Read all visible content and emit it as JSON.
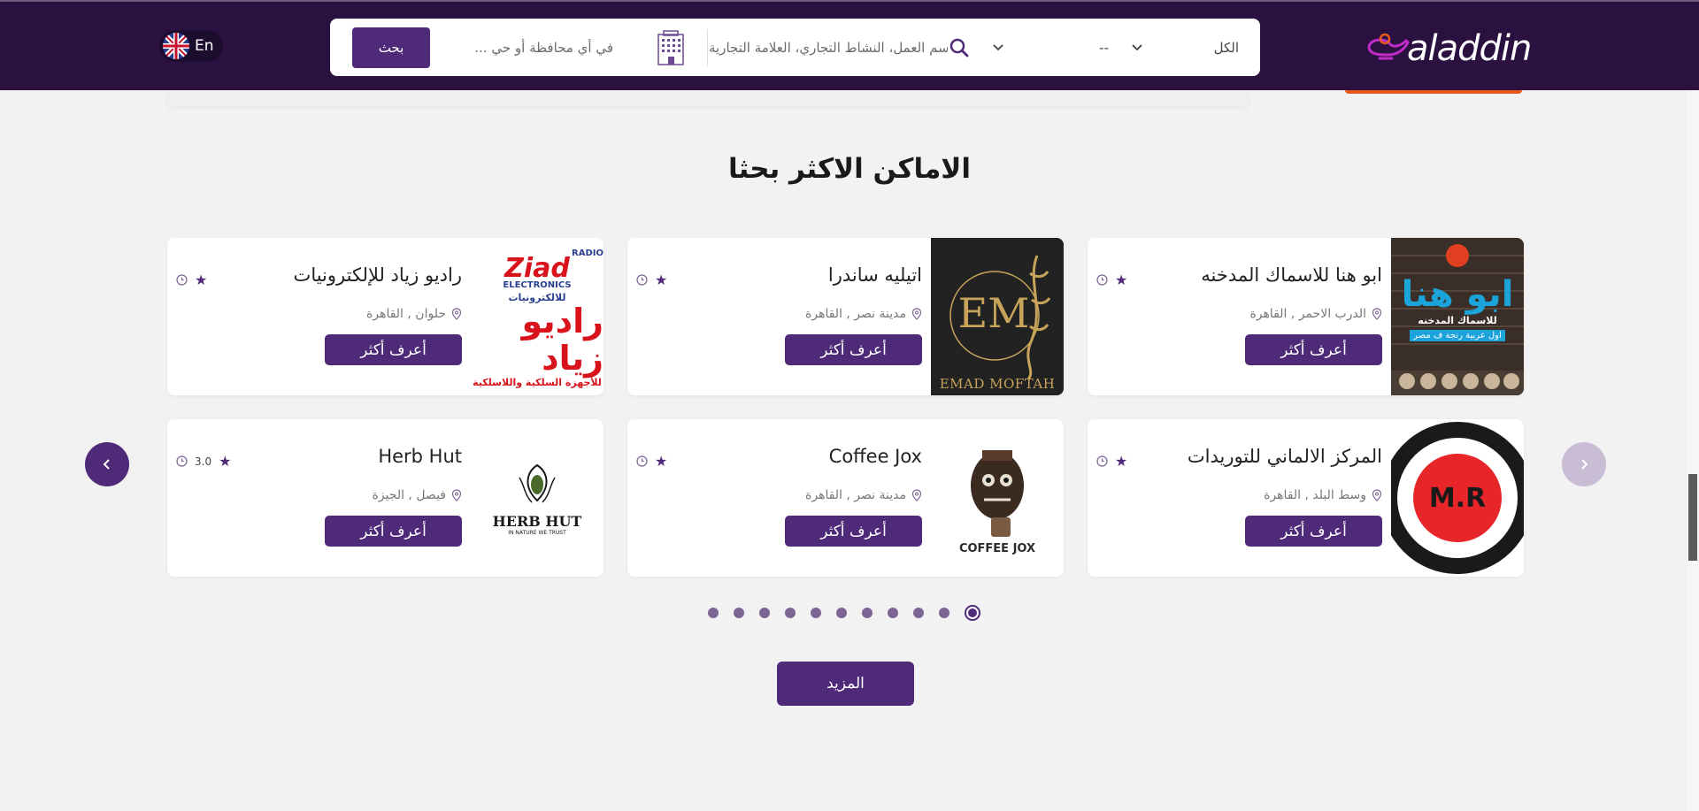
{
  "header": {
    "logo_text": "aladdin",
    "search_button": "بحث",
    "location_placeholder": "... في أي محافظة أو حي",
    "keyword_placeholder": "ابحث بـ اسم العمل، النشاط التجاري، العلامة التجارية",
    "select_category": "الكل",
    "select_sub": "--",
    "language": "En"
  },
  "section": {
    "title": "الاماكن الاكثر بحثا"
  },
  "cards": [
    {
      "name": "ابو هنا للاسماك المدخنه",
      "location": "الدرب الاحمر , القاهرة",
      "button": "أعرف أكثر",
      "rating": ""
    },
    {
      "name": "اتيليه ساندرا",
      "location": "مدينة نصر , القاهرة",
      "button": "أعرف أكثر",
      "rating": ""
    },
    {
      "name": "راديو زياد للإلكترونيات",
      "location": "حلوان , القاهرة",
      "button": "أعرف أكثر",
      "rating": ""
    },
    {
      "name": "المركز الالماني للتوريدات",
      "location": "وسط البلد , القاهرة",
      "button": "أعرف أكثر",
      "rating": ""
    },
    {
      "name": "Coffee Jox",
      "location": "مدينة نصر , القاهرة",
      "button": "أعرف أكثر",
      "rating": ""
    },
    {
      "name": "Herb Hut",
      "location": "فيصل , الجيزة",
      "button": "أعرف أكثر",
      "rating": "3.0"
    }
  ],
  "images": {
    "abu_hana_title": "ابو هنا",
    "abu_hana_sub": "للاسماك المدخنه",
    "abu_hana_tag": "اول عربية رنجة ف مصر",
    "em_initials": "EM",
    "em_name": "EMAD MOFTAH",
    "ziad_radio": "RADIO",
    "ziad_brand": "Ziad",
    "ziad_elec": "ELECTRONICS",
    "ziad_ar_sub": "للالكترونيات",
    "ziad_ar": "راديو زياد",
    "ziad_tag": "للأجهزة السلكية واللاسلكية",
    "mr_text": "M.R",
    "jox_text": "COFFEE JOX",
    "herb_title": "HERB HUT",
    "herb_sub": "IN NATURE WE TRUST"
  },
  "more_button": "المزيد",
  "pagination": {
    "total": 11,
    "active_index": 10
  },
  "colors": {
    "primary": "#4e2a78",
    "header_bg": "#2b1140",
    "accent_orange": "#e85a1e"
  }
}
